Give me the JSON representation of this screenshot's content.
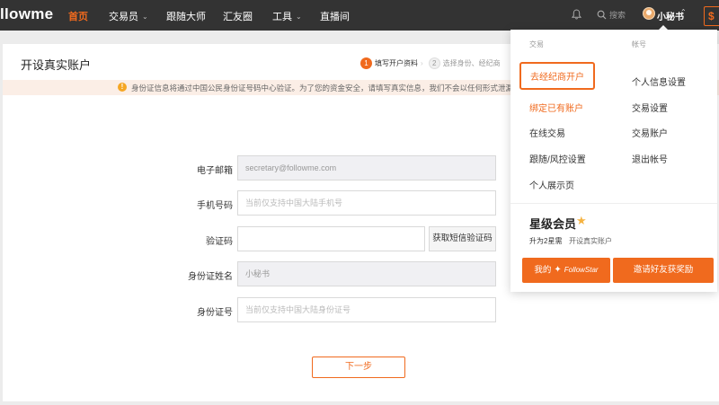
{
  "nav": {
    "logo": "llowme",
    "items": [
      {
        "label": "首页",
        "active": true
      },
      {
        "label": "交易员",
        "has_dropdown": true
      },
      {
        "label": "跟随大师"
      },
      {
        "label": "汇友圈"
      },
      {
        "label": "工具",
        "has_dropdown": true
      },
      {
        "label": "直播间"
      }
    ],
    "search_label": "搜索",
    "user_name": "小秘书",
    "wallet_symbol": "$"
  },
  "page": {
    "title": "开设真实账户",
    "steps": [
      {
        "num": "1",
        "label": "填写开户资料",
        "active": true
      },
      {
        "num": "2",
        "label": "选择身份、经纪商",
        "active": false
      }
    ],
    "notice": "身份证信息将通过中国公民身份证号码中心验证。为了您的资金安全，请填写真实信息，我们不会以任何形式泄漏。资料"
  },
  "form": {
    "email_label": "电子邮箱",
    "email_value": "secretary@followme.com",
    "phone_label": "手机号码",
    "phone_placeholder": "当前仅支持中国大陆手机号",
    "code_label": "验证码",
    "code_value": "",
    "sms_button": "获取短信验证码",
    "name_label": "身份证姓名",
    "name_value": "小秘书",
    "id_label": "身份证号",
    "id_placeholder": "当前仅支持中国大陆身份证号",
    "next_button": "下一步"
  },
  "dropdown": {
    "col_trade_title": "交易",
    "col_account_title": "帐号",
    "trade_items": [
      "去经纪商开户",
      "绑定已有账户",
      "在线交易",
      "跟随/风控设置",
      "个人展示页"
    ],
    "account_items": [
      "个人信息设置",
      "交易设置",
      "交易账户",
      "退出帐号"
    ],
    "member_title": "星级会员",
    "member_sub1": "升为2星需",
    "member_sub2": "开设真实账户",
    "btn_my": "我的",
    "btn_my_logo": "FollowStar",
    "btn_invite": "邀请好友获奖励"
  },
  "colors": {
    "accent": "#f06a1e",
    "nav_bg": "#333333",
    "notice_bg": "#fbeee6"
  }
}
